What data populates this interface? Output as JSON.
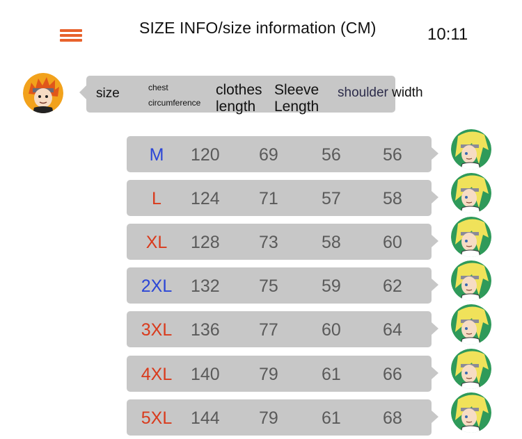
{
  "header": {
    "title": "SIZE INFO/size information (CM)",
    "clock": "10:11"
  },
  "columns": {
    "size": "size",
    "chest_line1": "chest",
    "chest_line2": "circumference",
    "length_line1": "clothes",
    "length_line2": "length",
    "sleeve_line1": "Sleeve",
    "sleeve_line2": "Length",
    "shoulder_a": "shoulder",
    "shoulder_b": " width"
  },
  "colors": {
    "menu_icon": "#e8622c",
    "bubble": "#c7c7c7",
    "size_blue": "#2b46d6",
    "size_red": "#d93a1c",
    "value_text": "#5a5a5a"
  },
  "rows": [
    {
      "size": "M",
      "size_color": "#2b46d6",
      "chest": "120",
      "length": "69",
      "sleeve": "56",
      "shoulder": "56"
    },
    {
      "size": "L",
      "size_color": "#d93a1c",
      "chest": "124",
      "length": "71",
      "sleeve": "57",
      "shoulder": "58"
    },
    {
      "size": "XL",
      "size_color": "#d93a1c",
      "chest": "128",
      "length": "73",
      "sleeve": "58",
      "shoulder": "60"
    },
    {
      "size": "2XL",
      "size_color": "#2b46d6",
      "chest": "132",
      "length": "75",
      "sleeve": "59",
      "shoulder": "62"
    },
    {
      "size": "3XL",
      "size_color": "#d93a1c",
      "chest": "136",
      "length": "77",
      "sleeve": "60",
      "shoulder": "64"
    },
    {
      "size": "4XL",
      "size_color": "#d93a1c",
      "chest": "140",
      "length": "79",
      "sleeve": "61",
      "shoulder": "66"
    },
    {
      "size": "5XL",
      "size_color": "#d93a1c",
      "chest": "144",
      "length": "79",
      "sleeve": "61",
      "shoulder": "68"
    }
  ]
}
